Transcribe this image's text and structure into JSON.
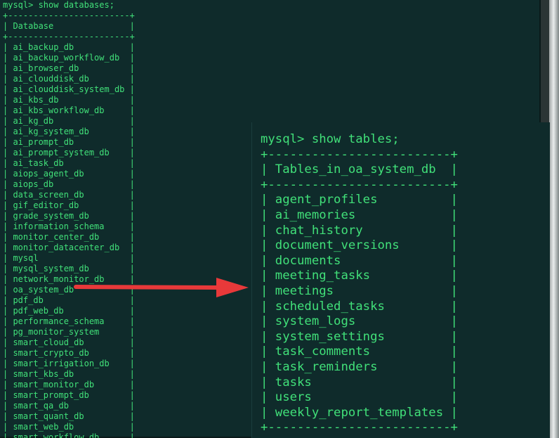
{
  "left_terminal": {
    "prompt": "mysql> show databases;",
    "border": "+------------------------+",
    "header": "| Database               |",
    "databases": [
      "ai_backup_db",
      "ai_backup_workflow_db",
      "ai_browser_db",
      "ai_clouddisk_db",
      "ai_clouddisk_system_db",
      "ai_kbs_db",
      "ai_kbs_workflow_db",
      "ai_kg_db",
      "ai_kg_system_db",
      "ai_prompt_db",
      "ai_prompt_system_db",
      "ai_task_db",
      "aiops_agent_db",
      "aiops_db",
      "data_screen_db",
      "gif_editor_db",
      "grade_system_db",
      "information_schema",
      "monitor_center_db",
      "monitor_datacenter_db",
      "mysql",
      "mysql_system_db",
      "network_monitor_db",
      "oa_system_db",
      "pdf_db",
      "pdf_web_db",
      "performance_schema",
      "pg_monitor_system",
      "smart_cloud_db",
      "smart_crypto_db",
      "smart_irrigation_db",
      "smart_kbs_db",
      "smart_monitor_db",
      "smart_prompt_db",
      "smart_qa_db",
      "smart_quant_db",
      "smart_web_db",
      "smart_workflow_db"
    ]
  },
  "right_terminal": {
    "prompt": "mysql> show tables;",
    "border": "+-------------------------+",
    "header": "| Tables_in_oa_system_db  |",
    "tables": [
      "agent_profiles",
      "ai_memories",
      "chat_history",
      "document_versions",
      "documents",
      "meeting_tasks",
      "meetings",
      "scheduled_tasks",
      "system_logs",
      "system_settings",
      "task_comments",
      "task_reminders",
      "tasks",
      "users",
      "weekly_report_templates"
    ]
  },
  "colors": {
    "terminal_bg": "#0f2b2b",
    "terminal_text": "#41e079",
    "arrow": "#e8393a"
  }
}
